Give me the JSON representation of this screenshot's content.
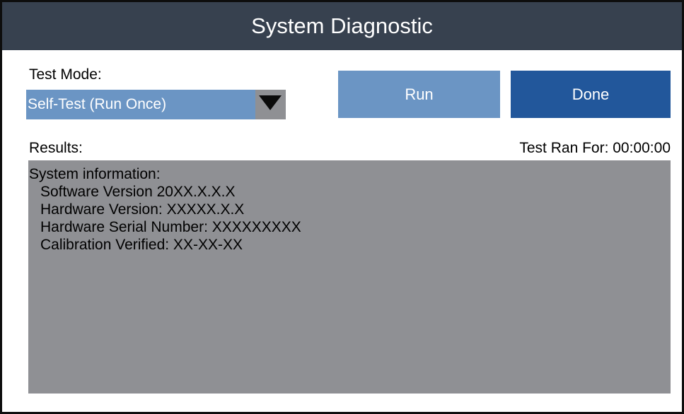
{
  "window": {
    "title": "System Diagnostic"
  },
  "test_mode": {
    "label": "Test Mode:",
    "selected": "Self-Test (Run Once)",
    "arrow_icon": "triangle-down-icon"
  },
  "actions": {
    "run_label": "Run",
    "done_label": "Done"
  },
  "results": {
    "label": "Results:",
    "elapsed": "Test Ran For: 00:00:00",
    "heading": "System information:",
    "lines": [
      "Software Version 20XX.X.X.X",
      "Hardware Version: XXXXX.X.X",
      "Hardware Serial Number: XXXXXXXXX",
      "Calibration Verified: XX-XX-XX"
    ]
  },
  "colors": {
    "titlebar": "#37414f",
    "accent_light": "#6b95c4",
    "accent_dark": "#22579b",
    "panel_gray": "#8f9094"
  }
}
